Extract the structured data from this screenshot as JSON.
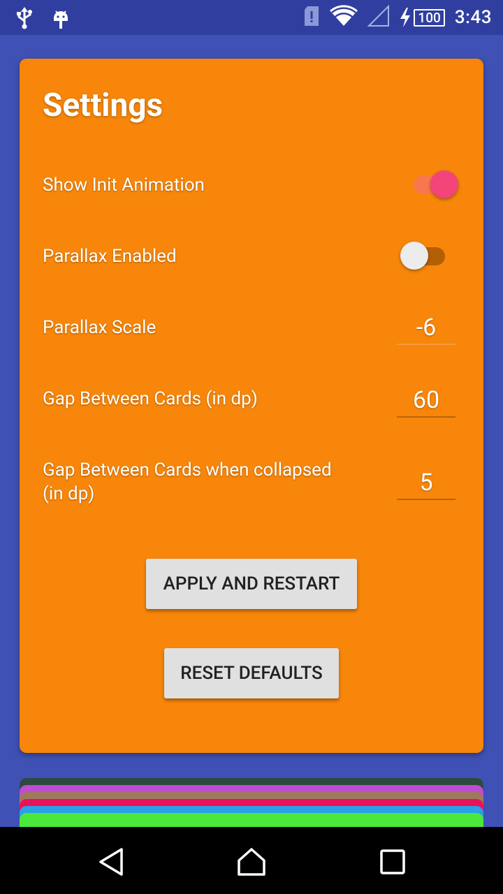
{
  "status_bar": {
    "time": "3:43",
    "battery_level": "100",
    "left_icons": [
      "usb-icon",
      "android-debug-icon"
    ],
    "right_icons": [
      "sim-alert-icon",
      "wifi-icon",
      "cell-signal-icon",
      "charging-icon",
      "battery-icon"
    ]
  },
  "settings": {
    "title": "Settings",
    "show_init_animation": {
      "label": "Show Init Animation",
      "enabled": true
    },
    "parallax_enabled": {
      "label": "Parallax Enabled",
      "enabled": false
    },
    "parallax_scale": {
      "label": "Parallax Scale",
      "value": "-6"
    },
    "gap_between_cards": {
      "label": "Gap Between Cards (in dp)",
      "value": "60"
    },
    "gap_collapsed": {
      "label_line1": "Gap Between Cards when collapsed",
      "label_line2": "(in dp)",
      "value": "5"
    },
    "apply_button": "APPLY AND RESTART",
    "reset_button": "RESET DEFAULTS"
  },
  "stacked_card_colors": [
    "#2e4a3e",
    "#c24bd6",
    "#9e7a5c",
    "#e8125a",
    "#2aa0e8",
    "#4be83a"
  ],
  "colors": {
    "background": "#3f51b5",
    "status_bar": "#303f9f",
    "settings_card": "#f7860a",
    "switch_on_thumb": "#f3457a",
    "button": "#e0e0e0"
  },
  "nav_bar": {
    "icons": [
      "back-icon",
      "home-icon",
      "recents-icon"
    ]
  }
}
